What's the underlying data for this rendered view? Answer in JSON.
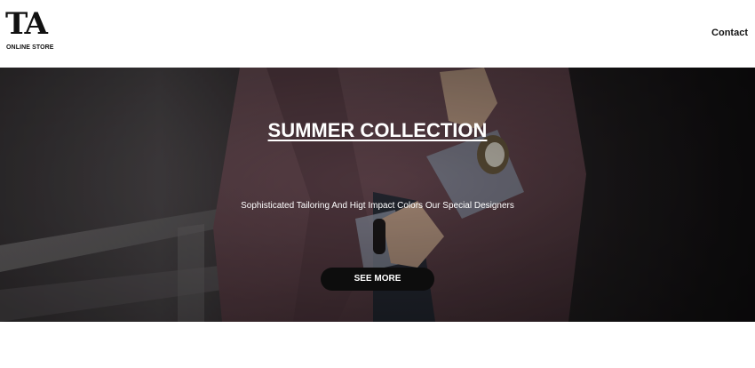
{
  "header": {
    "logo_mark": "TA",
    "logo_subtitle": "ONLINE STORE",
    "nav": {
      "contact_label": "Contact"
    }
  },
  "hero": {
    "title": "SUMMER COLLECTION",
    "subtitle": "Sophisticated Tailoring And Higt Impact Colors Our Special Designers",
    "cta_label": "SEE MORE"
  },
  "colors": {
    "header_bg": "#ffffff",
    "text_dark": "#111111",
    "hero_text": "#ffffff",
    "cta_bg": "#0d0d0d",
    "jacket": "#7a5a62"
  }
}
